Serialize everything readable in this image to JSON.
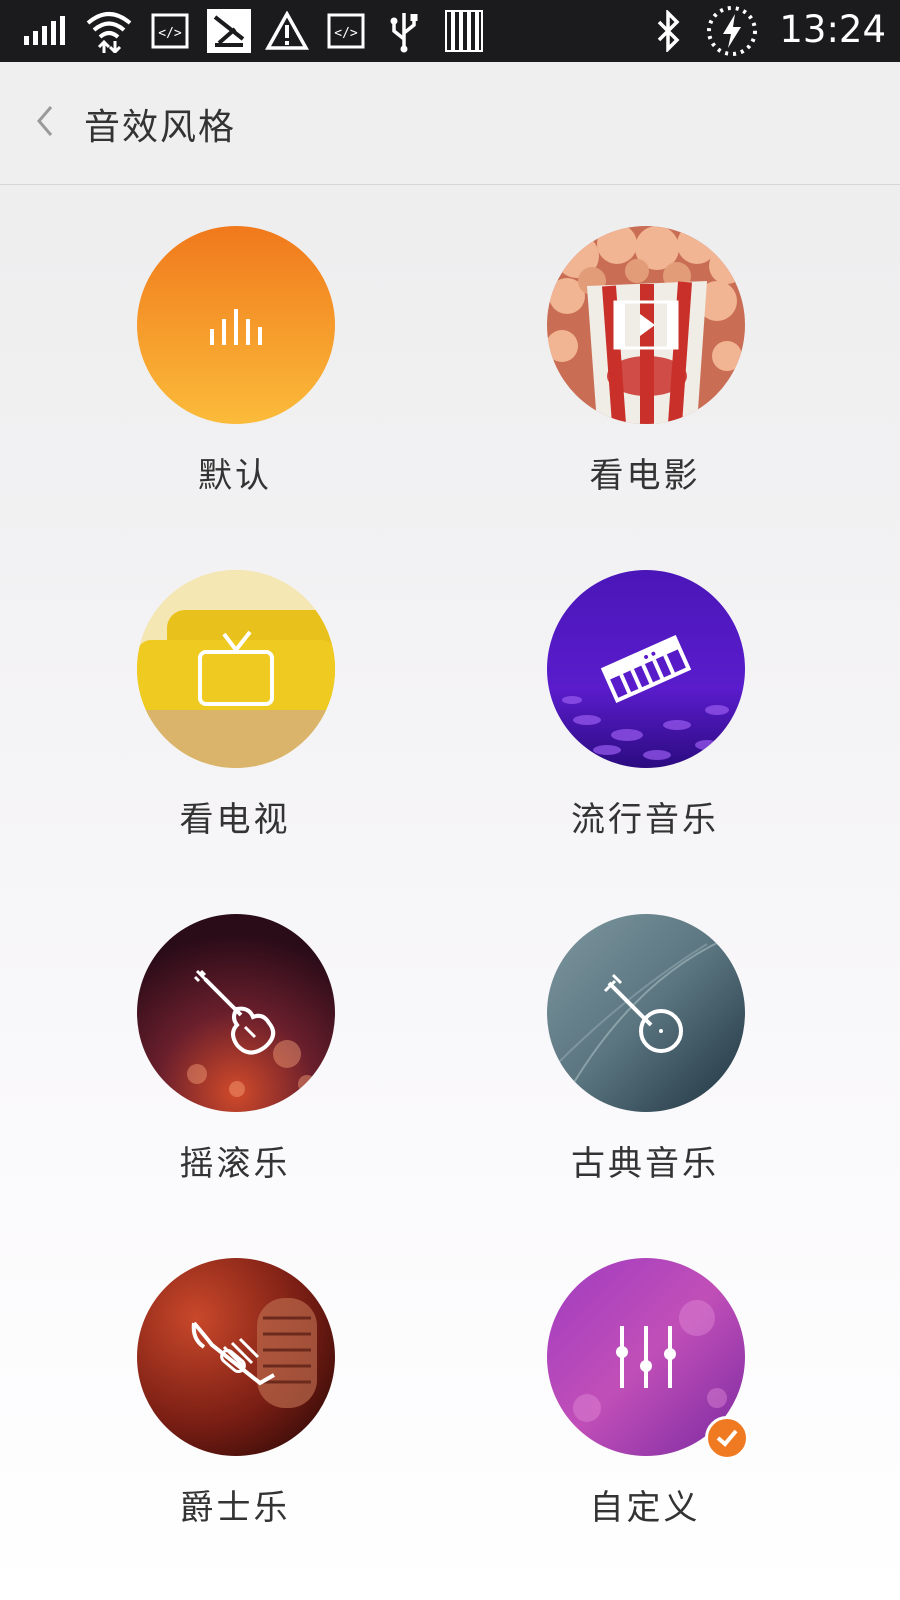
{
  "status_bar": {
    "time": "13:24",
    "icons": [
      "signal-icon",
      "wifi-icon",
      "code-icon",
      "app-icon",
      "warning-icon",
      "code-icon",
      "usb-icon",
      "storage-icon",
      "bluetooth-icon",
      "battery-charging-icon"
    ]
  },
  "header": {
    "title": "音效风格",
    "back_icon": "chevron-left-icon"
  },
  "presets": [
    {
      "label": "默认",
      "icon": "equalizer-bars-icon",
      "bg": "orange-gradient"
    },
    {
      "label": "看电影",
      "icon": "film-play-icon",
      "bg": "popcorn"
    },
    {
      "label": "看电视",
      "icon": "tv-icon",
      "bg": "yellow-sofa"
    },
    {
      "label": "流行音乐",
      "icon": "keyboard-icon",
      "bg": "purple-stage"
    },
    {
      "label": "摇滚乐",
      "icon": "electric-guitar-icon",
      "bg": "dark-red-bokeh"
    },
    {
      "label": "古典音乐",
      "icon": "banjo-icon",
      "bg": "blue-feather"
    },
    {
      "label": "爵士乐",
      "icon": "trumpet-icon",
      "bg": "red-microphone"
    },
    {
      "label": "自定义",
      "icon": "sliders-icon",
      "bg": "purple-pink",
      "selected": true
    }
  ],
  "colors": {
    "accent": "#f07a22",
    "status_bar": "#1b1b1d",
    "text": "#333333"
  }
}
